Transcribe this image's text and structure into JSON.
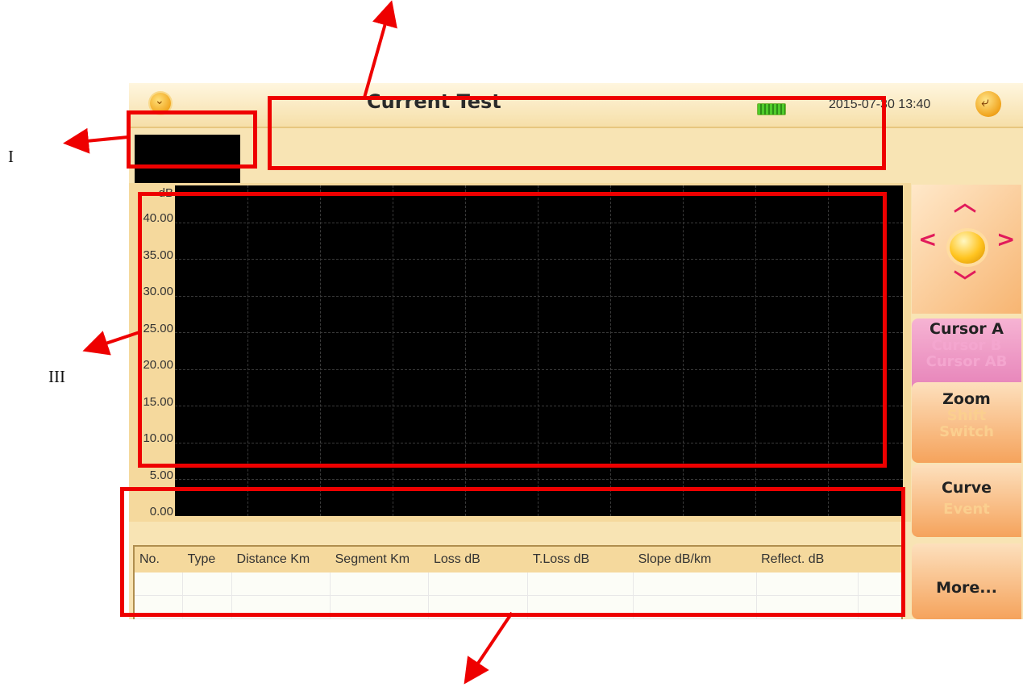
{
  "header": {
    "title": "Current Test",
    "datetime": "2015-07-30 13:40"
  },
  "plot": {
    "y_unit": "dB",
    "y_ticks": [
      "40.00",
      "35.00",
      "30.00",
      "25.00",
      "20.00",
      "15.00",
      "10.00",
      "5.00",
      "0.00"
    ]
  },
  "side_buttons": {
    "cursor": {
      "primary": "Cursor A",
      "secondary": [
        "Cursor B",
        "Cursor AB"
      ]
    },
    "zoom": {
      "primary": "Zoom",
      "secondary": [
        "Shift",
        "Switch"
      ]
    },
    "curve": {
      "primary": "Curve",
      "secondary": [
        "Event"
      ]
    },
    "more": {
      "primary": "More..."
    }
  },
  "event_table": {
    "columns": [
      "No.",
      "Type",
      "Distance Km",
      "Segment Km",
      "Loss dB",
      "T.Loss dB",
      "Slope dB/km",
      "Reflect. dB",
      ""
    ],
    "rows": [
      [
        "",
        "",
        "",
        "",
        "",
        "",
        "",
        "",
        ""
      ],
      [
        "",
        "",
        "",
        "",
        "",
        "",
        "",
        "",
        ""
      ]
    ]
  },
  "annotations": {
    "label_1": "I",
    "label_3": "III"
  },
  "colors": {
    "annotation": "#ee0000",
    "screen_bg": "#f8e4b4",
    "plot_bg": "#000000"
  }
}
